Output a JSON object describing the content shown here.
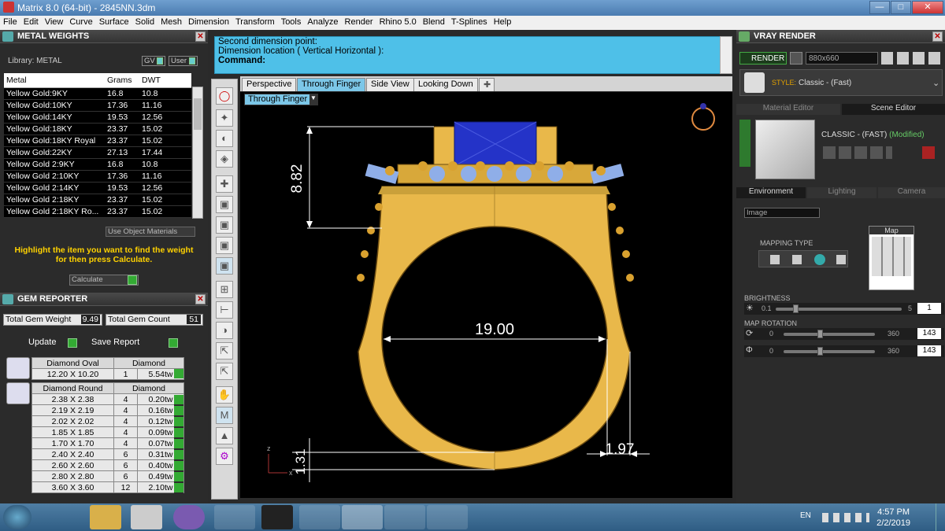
{
  "window": {
    "title": "Matrix 8.0 (64-bit) - 2845NN.3dm"
  },
  "menu": [
    "File",
    "Edit",
    "View",
    "Curve",
    "Surface",
    "Solid",
    "Mesh",
    "Dimension",
    "Transform",
    "Tools",
    "Analyze",
    "Render",
    "Rhino 5.0",
    "Blend",
    "T-Splines",
    "Help"
  ],
  "metal": {
    "title": "METAL WEIGHTS",
    "library": "Library: METAL",
    "gv": "GV",
    "user": "User",
    "cols": [
      "Metal",
      "Grams",
      "DWT"
    ],
    "rows": [
      [
        "Yellow Gold:9KY",
        "16.8",
        "10.8"
      ],
      [
        "Yellow Gold:10KY",
        "17.36",
        "11.16"
      ],
      [
        "Yellow Gold:14KY",
        "19.53",
        "12.56"
      ],
      [
        "Yellow Gold:18KY",
        "23.37",
        "15.02"
      ],
      [
        "Yellow Gold:18KY Royal",
        "23.37",
        "15.02"
      ],
      [
        "Yellow Gold:22KY",
        "27.13",
        "17.44"
      ],
      [
        "Yellow Gold 2:9KY",
        "16.8",
        "10.8"
      ],
      [
        "Yellow Gold 2:10KY",
        "17.36",
        "11.16"
      ],
      [
        "Yellow Gold 2:14KY",
        "19.53",
        "12.56"
      ],
      [
        "Yellow Gold 2:18KY",
        "23.37",
        "15.02"
      ],
      [
        "Yellow Gold 2:18KY Ro...",
        "23.37",
        "15.02"
      ]
    ],
    "use_obj": "Use Object Materials",
    "hint": "Highlight the item you want to find the weight for then press Calculate.",
    "calc": "Calculate"
  },
  "gem": {
    "title": "GEM REPORTER",
    "tw_label": "Total Gem Weight",
    "tw": "9.49",
    "tc_label": "Total Gem Count",
    "tc": "51",
    "update": "Update",
    "save": "Save Report",
    "oval": {
      "name": "Diamond Oval",
      "mat": "Diamond",
      "size": "12.20 X 10.20",
      "count": "1",
      "tw": "5.54tw"
    },
    "round": {
      "name": "Diamond Round",
      "mat": "Diamond",
      "rows": [
        [
          "2.38 X 2.38",
          "4",
          "0.20tw"
        ],
        [
          "2.19 X 2.19",
          "4",
          "0.16tw"
        ],
        [
          "2.02 X 2.02",
          "4",
          "0.12tw"
        ],
        [
          "1.85 X 1.85",
          "4",
          "0.09tw"
        ],
        [
          "1.70 X 1.70",
          "4",
          "0.07tw"
        ],
        [
          "2.40 X 2.40",
          "6",
          "0.31tw"
        ],
        [
          "2.60 X 2.60",
          "6",
          "0.40tw"
        ],
        [
          "2.80 X 2.80",
          "6",
          "0.49tw"
        ],
        [
          "3.60 X 3.60",
          "12",
          "2.10tw"
        ]
      ]
    }
  },
  "command": {
    "line1": "Second dimension point:",
    "line2": "Dimension location ( Vertical  Horizontal ):",
    "prompt": "Command:"
  },
  "tabs": [
    "Perspective",
    "Through Finger",
    "Side View",
    "Looking Down"
  ],
  "viewport": {
    "name": "Through Finger",
    "dims": {
      "top": "8.82",
      "inner": "19.00",
      "bottom": "1.31",
      "side": "1.97"
    },
    "axis_z": "z",
    "axis_x": "x"
  },
  "vray": {
    "title": "VRAY RENDER",
    "render": "RENDER",
    "res": "880x660",
    "style_label": "STYLE:",
    "style": "Classic - (Fast)",
    "tab_mat": "Material Editor",
    "tab_scene": "Scene Editor",
    "preset": "CLASSIC - (FAST)",
    "modified": "(Modified)",
    "tabs": [
      "Environment",
      "Lighting",
      "Camera"
    ],
    "env": "Image",
    "mapping": "MAPPING TYPE",
    "map": "Map",
    "brightness": "BRIGHTNESS",
    "b_min": "0.1",
    "b_max": "5",
    "b_val": "1",
    "rotation": "MAP ROTATION",
    "r1_min": "0",
    "r1_max": "360",
    "r1_val": "143",
    "r2_min": "0",
    "r2_max": "360",
    "r2_val": "143"
  },
  "taskbar": {
    "lang": "EN",
    "time": "4:57 PM",
    "date": "2/2/2019"
  }
}
